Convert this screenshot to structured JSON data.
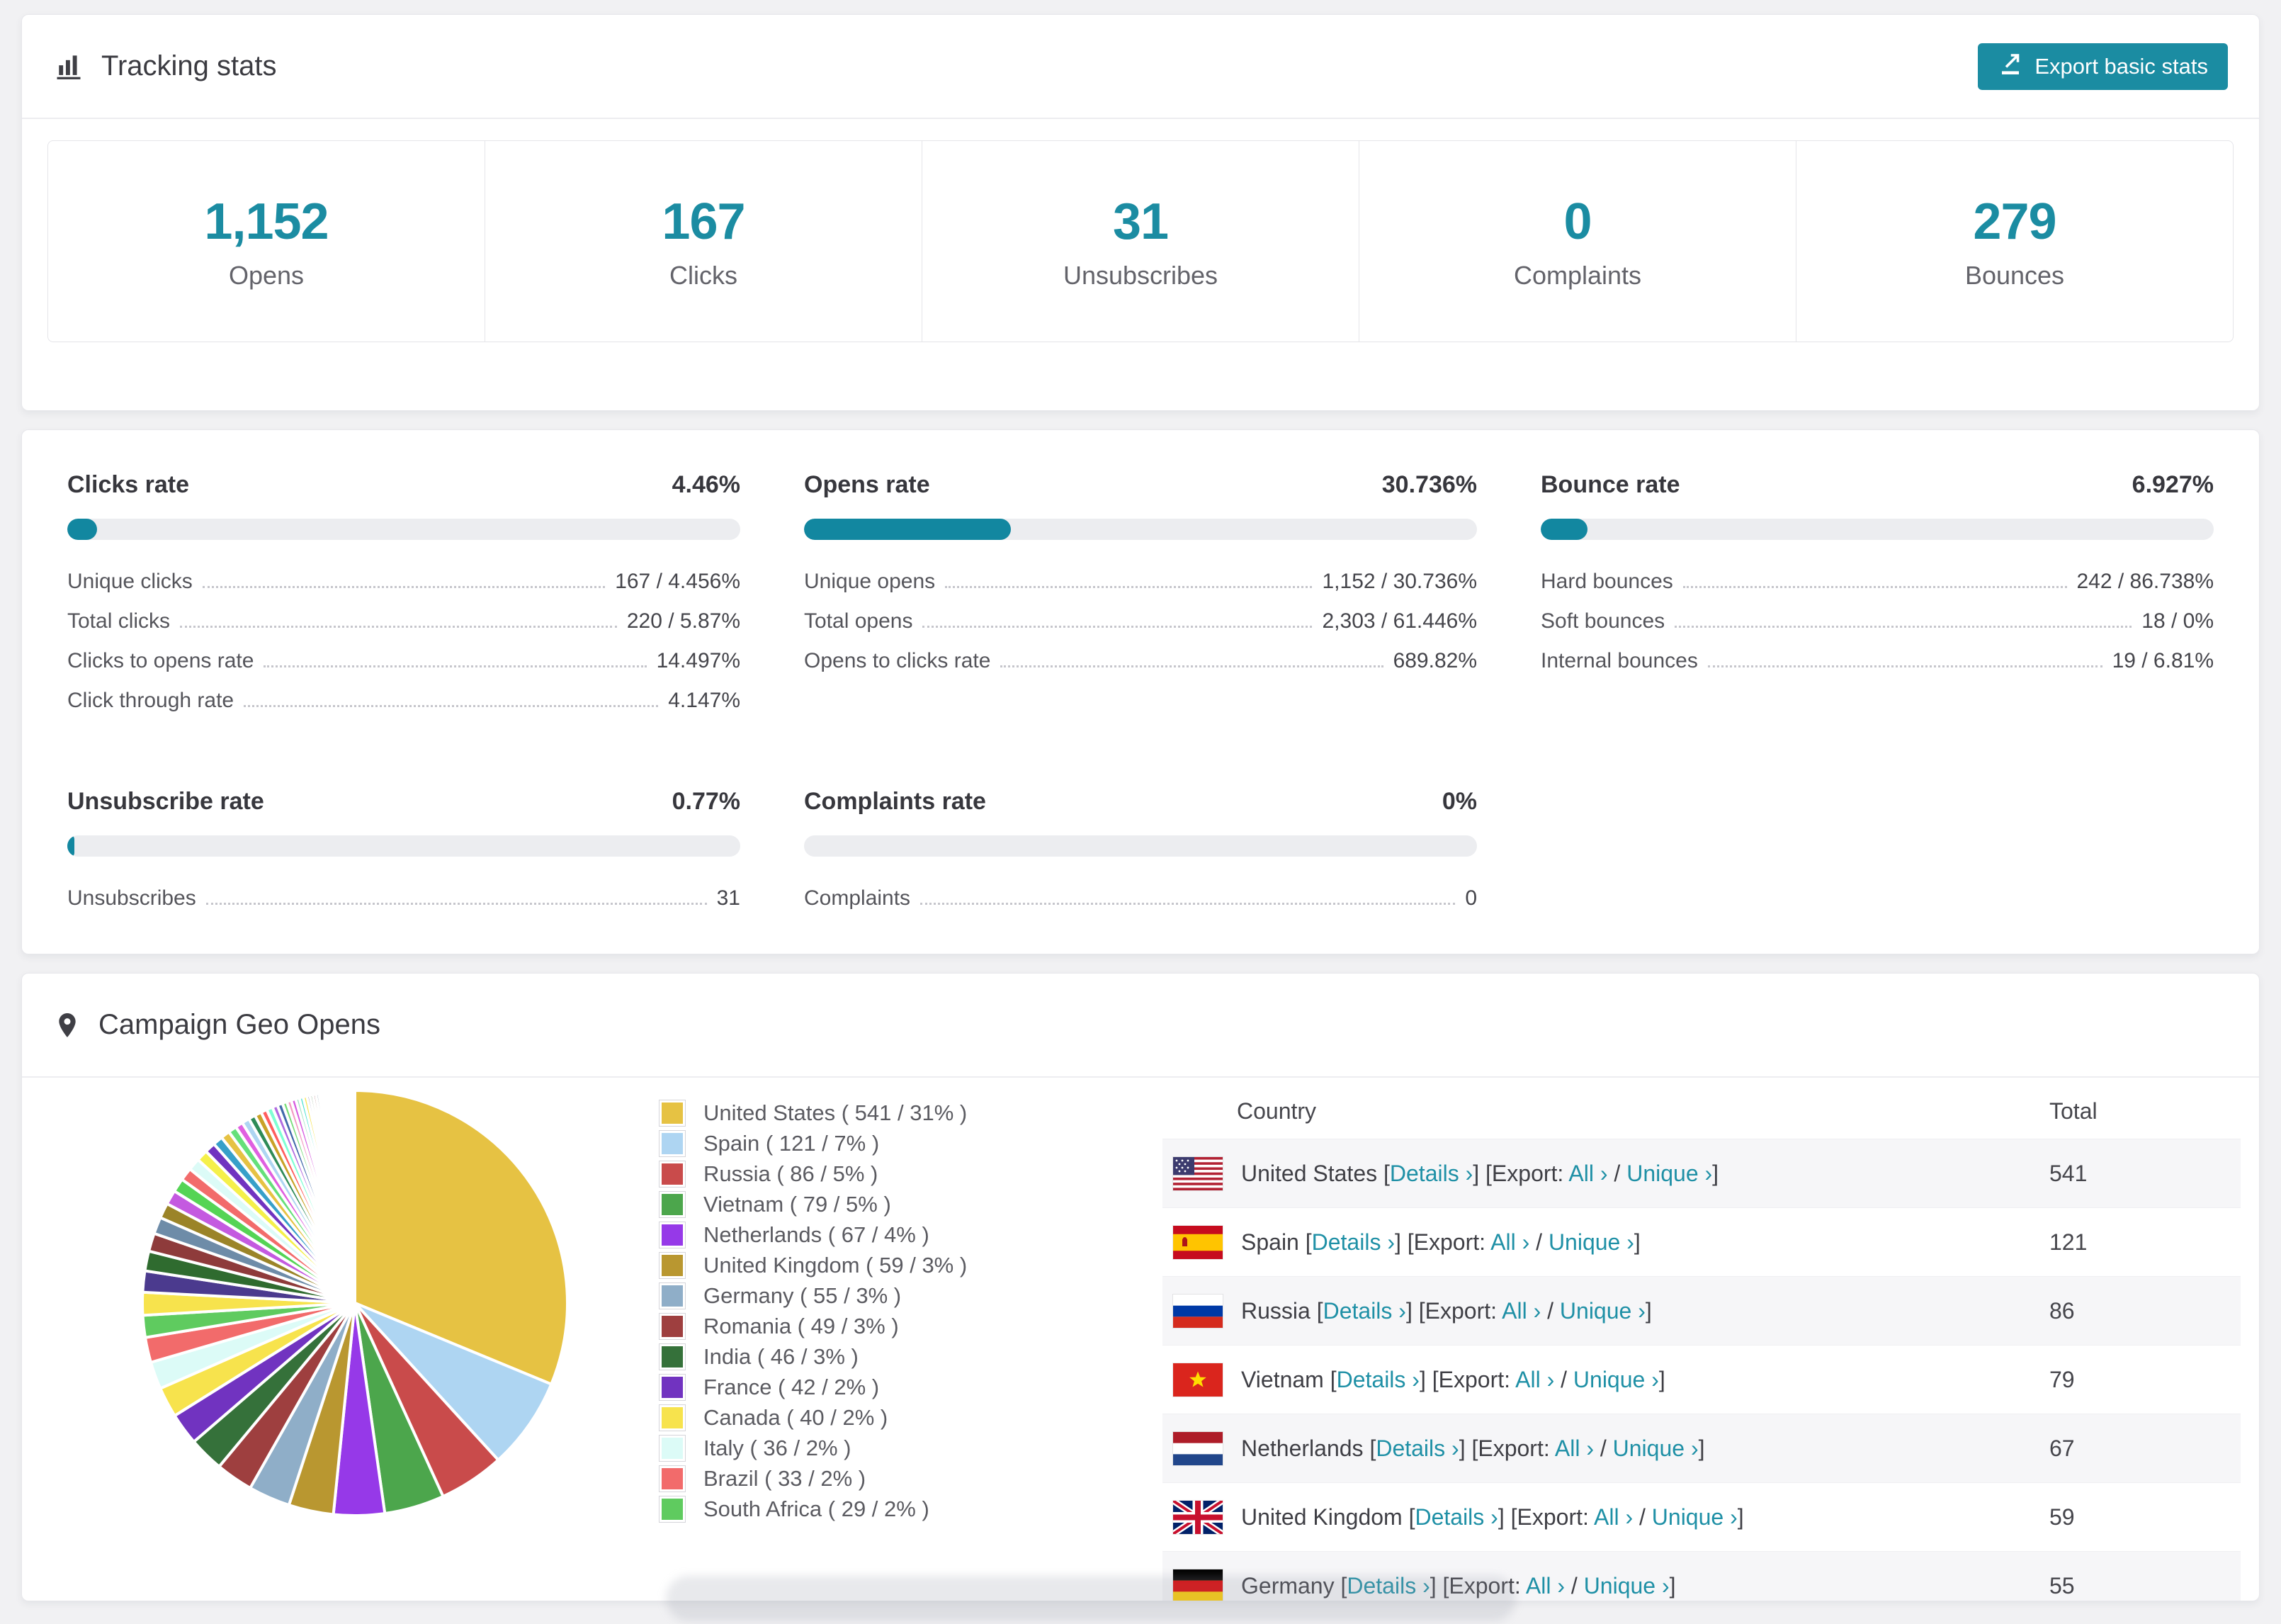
{
  "app": {
    "page_bg": "#F1F1F3",
    "accent_teal": "#1B8CA2"
  },
  "tracking": {
    "title": "Tracking stats",
    "export_button": "Export basic stats",
    "stats": [
      {
        "value": "1,152",
        "label": "Opens"
      },
      {
        "value": "167",
        "label": "Clicks"
      },
      {
        "value": "31",
        "label": "Unsubscribes"
      },
      {
        "value": "0",
        "label": "Complaints"
      },
      {
        "value": "279",
        "label": "Bounces"
      }
    ]
  },
  "rates": {
    "blocks": [
      {
        "title": "Clicks rate",
        "value": "4.46%",
        "pct": 4.46,
        "rows": [
          {
            "label": "Unique clicks",
            "value": "167 / 4.456%"
          },
          {
            "label": "Total clicks",
            "value": "220 / 5.87%"
          },
          {
            "label": "Clicks to opens rate",
            "value": "14.497%"
          },
          {
            "label": "Click through rate",
            "value": "4.147%"
          }
        ]
      },
      {
        "title": "Opens rate",
        "value": "30.736%",
        "pct": 30.736,
        "rows": [
          {
            "label": "Unique opens",
            "value": "1,152 / 30.736%"
          },
          {
            "label": "Total opens",
            "value": "2,303 / 61.446%"
          },
          {
            "label": "Opens to clicks rate",
            "value": "689.82%"
          }
        ]
      },
      {
        "title": "Bounce rate",
        "value": "6.927%",
        "pct": 6.927,
        "rows": [
          {
            "label": "Hard bounces",
            "value": "242 / 86.738%"
          },
          {
            "label": "Soft bounces",
            "value": "18 / 0%"
          },
          {
            "label": "Internal bounces",
            "value": "19 / 6.81%"
          }
        ]
      },
      {
        "title": "Unsubscribe rate",
        "value": "0.77%",
        "pct": 0.77,
        "rows": [
          {
            "label": "Unsubscribes",
            "value": "31"
          }
        ]
      },
      {
        "title": "Complaints rate",
        "value": "0%",
        "pct": 0,
        "rows": [
          {
            "label": "Complaints",
            "value": "0"
          }
        ]
      }
    ]
  },
  "geo": {
    "title": "Campaign Geo Opens",
    "table": {
      "columns": [
        "Country",
        "Total"
      ],
      "link_labels": {
        "details": "Details ›",
        "export": "Export:",
        "all": "All ›",
        "unique": "Unique ›"
      },
      "rows": [
        {
          "country": "United States",
          "flag": "us",
          "total": "541"
        },
        {
          "country": "Spain",
          "flag": "es",
          "total": "121"
        },
        {
          "country": "Russia",
          "flag": "ru",
          "total": "86"
        },
        {
          "country": "Vietnam",
          "flag": "vn",
          "total": "79"
        },
        {
          "country": "Netherlands",
          "flag": "nl",
          "total": "67"
        },
        {
          "country": "United Kingdom",
          "flag": "gb",
          "total": "59"
        },
        {
          "country": "Germany",
          "flag": "de",
          "total": "55"
        }
      ]
    }
  },
  "chart_data": {
    "type": "pie",
    "title": "Campaign Geo Opens",
    "legend_position": "right-of-pie",
    "slices": [
      {
        "label": "United States",
        "value": 541,
        "pct": "31%",
        "color": "#E6C243"
      },
      {
        "label": "Spain",
        "value": 121,
        "pct": "7%",
        "color": "#AED5F2"
      },
      {
        "label": "Russia",
        "value": 86,
        "pct": "5%",
        "color": "#C94B4B"
      },
      {
        "label": "Vietnam",
        "value": 79,
        "pct": "5%",
        "color": "#4CA64C"
      },
      {
        "label": "Netherlands",
        "value": 67,
        "pct": "4%",
        "color": "#9639E8"
      },
      {
        "label": "United Kingdom",
        "value": 59,
        "pct": "3%",
        "color": "#B99730"
      },
      {
        "label": "Germany",
        "value": 55,
        "pct": "3%",
        "color": "#8FAEC8"
      },
      {
        "label": "Romania",
        "value": 49,
        "pct": "3%",
        "color": "#9E3F3F"
      },
      {
        "label": "India",
        "value": 46,
        "pct": "3%",
        "color": "#35713A"
      },
      {
        "label": "France",
        "value": 42,
        "pct": "2%",
        "color": "#7133C0"
      },
      {
        "label": "Canada",
        "value": 40,
        "pct": "2%",
        "color": "#F7E34D"
      },
      {
        "label": "Italy",
        "value": 36,
        "pct": "2%",
        "color": "#DCFBF7"
      },
      {
        "label": "Brazil",
        "value": 33,
        "pct": "2%",
        "color": "#F26B6B"
      },
      {
        "label": "South Africa",
        "value": 29,
        "pct": "2%",
        "color": "#5FCB5F"
      }
    ],
    "other_slices_values": [
      30,
      28,
      26,
      24,
      22,
      20,
      19,
      18,
      17,
      16,
      15,
      14,
      13,
      12,
      11,
      10,
      10,
      9,
      9,
      8,
      8,
      7,
      7,
      6,
      6,
      6,
      5,
      5,
      5,
      4,
      4,
      4,
      4,
      3,
      3,
      3,
      3,
      3,
      2,
      2,
      2,
      2,
      2,
      2,
      2,
      2,
      1,
      1,
      1,
      1,
      1,
      1,
      1,
      1,
      1,
      1,
      1,
      1,
      1,
      1,
      1,
      1
    ],
    "other_slices_palette": [
      "#F7E34D",
      "#4B3A8E",
      "#2F6B2F",
      "#8E3B3B",
      "#6E8CA8",
      "#9B8428",
      "#C45AE0",
      "#55D455",
      "#F26B6B",
      "#DCFBF7",
      "#F5F04A",
      "#7133C0",
      "#37A0C9",
      "#E6C243",
      "#66E07A",
      "#E060E0",
      "#AED5F2",
      "#2E8B57",
      "#C9A227",
      "#FF5E5E",
      "#7FFFD4",
      "#B06BE0",
      "#4169AA",
      "#77DD77",
      "#F49AC2",
      "#D65BE0",
      "#9FE2BF",
      "#40E0D0"
    ]
  }
}
